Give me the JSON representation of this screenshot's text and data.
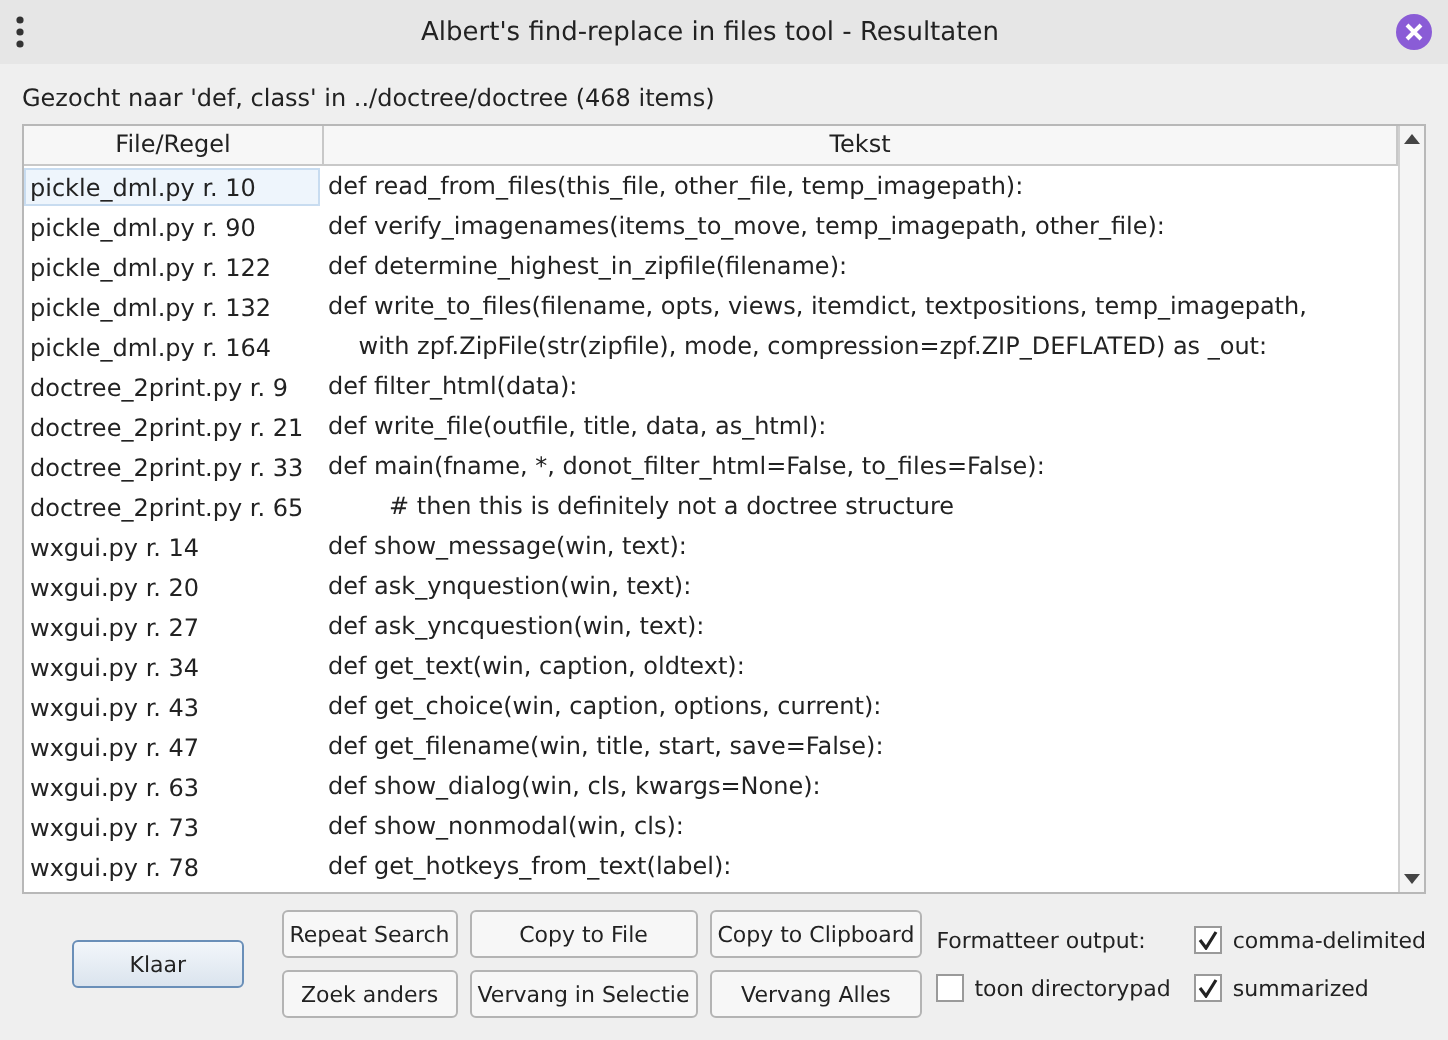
{
  "window": {
    "title": "Albert's find-replace in files tool - Resultaten"
  },
  "summary": "Gezocht naar 'def, class' in ../doctree/doctree (468 items)",
  "table": {
    "columns": [
      "File/Regel",
      "Tekst"
    ],
    "rows": [
      {
        "file": "pickle_dml.py r. 10",
        "text": "def read_from_files(this_file, other_file, temp_imagepath):",
        "selected": true
      },
      {
        "file": "pickle_dml.py r. 90",
        "text": "def verify_imagenames(items_to_move, temp_imagepath, other_file):",
        "selected": false
      },
      {
        "file": "pickle_dml.py r. 122",
        "text": "def determine_highest_in_zipfile(filename):",
        "selected": false
      },
      {
        "file": "pickle_dml.py r. 132",
        "text": "def write_to_files(filename, opts, views, itemdict, textpositions, temp_imagepath,",
        "selected": false
      },
      {
        "file": "pickle_dml.py r. 164",
        "text": "    with zpf.ZipFile(str(zipfile), mode, compression=zpf.ZIP_DEFLATED) as _out:",
        "selected": false
      },
      {
        "file": "doctree_2print.py r. 9",
        "text": "def filter_html(data):",
        "selected": false
      },
      {
        "file": "doctree_2print.py r. 21",
        "text": "def write_file(outfile, title, data, as_html):",
        "selected": false
      },
      {
        "file": "doctree_2print.py r. 33",
        "text": "def main(fname, *, donot_filter_html=False, to_files=False):",
        "selected": false
      },
      {
        "file": "doctree_2print.py r. 65",
        "text": "        # then this is definitely not a doctree structure",
        "selected": false
      },
      {
        "file": "wxgui.py r. 14",
        "text": "def show_message(win, text):",
        "selected": false
      },
      {
        "file": "wxgui.py r. 20",
        "text": "def ask_ynquestion(win, text):",
        "selected": false
      },
      {
        "file": "wxgui.py r. 27",
        "text": "def ask_yncquestion(win, text):",
        "selected": false
      },
      {
        "file": "wxgui.py r. 34",
        "text": "def get_text(win, caption, oldtext):",
        "selected": false
      },
      {
        "file": "wxgui.py r. 43",
        "text": "def get_choice(win, caption, options, current):",
        "selected": false
      },
      {
        "file": "wxgui.py r. 47",
        "text": "def get_filename(win, title, start, save=False):",
        "selected": false
      },
      {
        "file": "wxgui.py r. 63",
        "text": "def show_dialog(win, cls, kwargs=None):",
        "selected": false
      },
      {
        "file": "wxgui.py r. 73",
        "text": "def show_nonmodal(win, cls):",
        "selected": false
      },
      {
        "file": "wxgui.py r. 78",
        "text": "def get_hotkeys_from_text(label):",
        "selected": false
      }
    ]
  },
  "done_button": {
    "label": "Klaar"
  },
  "buttons": [
    {
      "label": "Repeat Search"
    },
    {
      "label": "Copy to File"
    },
    {
      "label": "Copy to Clipboard"
    },
    {
      "label": "Zoek anders"
    },
    {
      "label": "Vervang in Selectie"
    },
    {
      "label": "Vervang Alles"
    }
  ],
  "format_label": "Formatteer output:",
  "options": [
    {
      "label": "comma-delimited",
      "checked": true
    },
    {
      "label": "toon directorypad",
      "checked": false
    },
    {
      "label": "summarized",
      "checked": true
    }
  ]
}
